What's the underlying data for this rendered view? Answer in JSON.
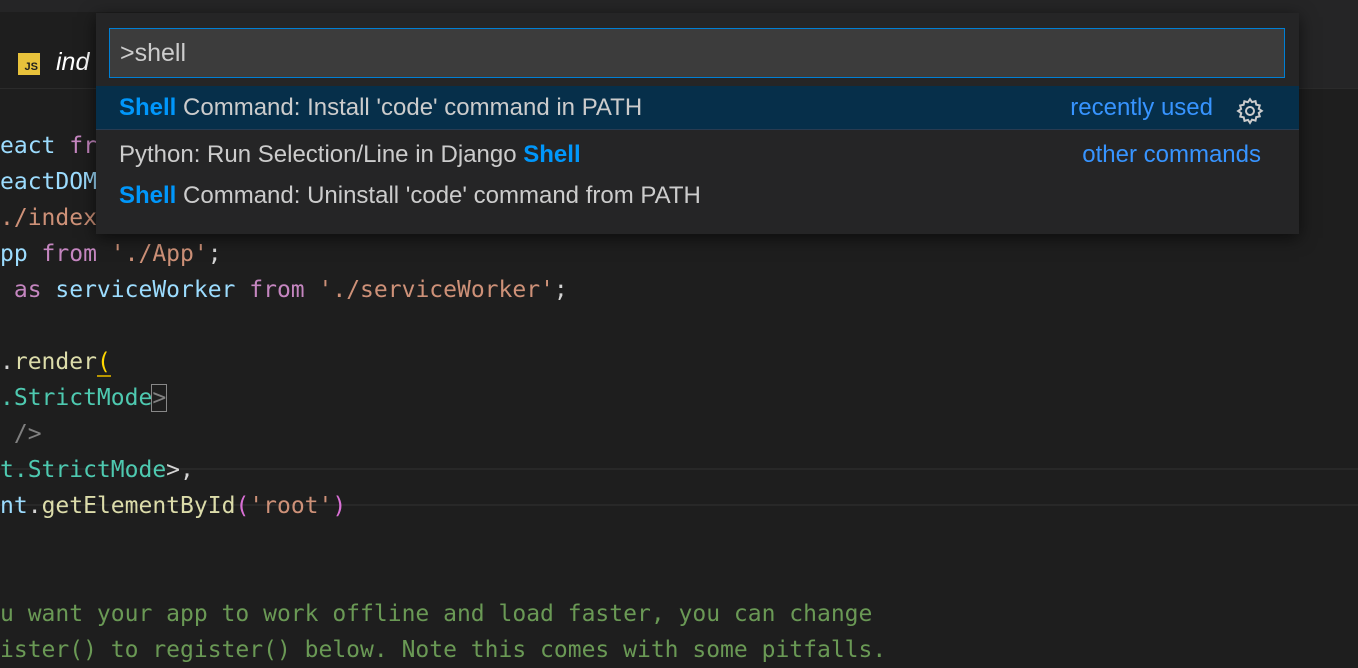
{
  "tab": {
    "icon_text": "JS",
    "title": "ind"
  },
  "code_lines": [
    {
      "segments": [
        {
          "t": "eact ",
          "c": "var"
        },
        {
          "t": "fr",
          "c": "kw"
        }
      ]
    },
    {
      "segments": [
        {
          "t": "eactDOM",
          "c": "var"
        }
      ]
    },
    {
      "segments": [
        {
          "t": "./index",
          "c": "str"
        }
      ]
    },
    {
      "segments": [
        {
          "t": "pp ",
          "c": "var"
        },
        {
          "t": "from ",
          "c": "kw"
        },
        {
          "t": "'./App'",
          "c": "str"
        },
        {
          "t": ";",
          "c": "punc"
        }
      ]
    },
    {
      "segments": [
        {
          "t": " as ",
          "c": "kw"
        },
        {
          "t": "serviceWorker ",
          "c": "var"
        },
        {
          "t": "from ",
          "c": "kw"
        },
        {
          "t": "'./serviceWorker'",
          "c": "str"
        },
        {
          "t": ";",
          "c": "punc"
        }
      ]
    },
    {
      "segments": []
    },
    {
      "segments": [
        {
          "t": ".",
          "c": "punc"
        },
        {
          "t": "render",
          "c": "fn"
        },
        {
          "t": "(",
          "c": "brY"
        }
      ]
    },
    {
      "segments": [
        {
          "t": ".StrictMode",
          "c": "tag"
        },
        {
          "t": ">",
          "c": "gray"
        }
      ]
    },
    {
      "segments": [
        {
          "t": " />",
          "c": "gray"
        }
      ]
    },
    {
      "segments": [
        {
          "t": "t.StrictMode",
          "c": "tag"
        },
        {
          "t": ">,",
          "c": "punc"
        }
      ]
    },
    {
      "segments": [
        {
          "t": "nt",
          "c": "var"
        },
        {
          "t": ".",
          "c": "punc"
        },
        {
          "t": "getElementById",
          "c": "fn"
        },
        {
          "t": "(",
          "c": "br"
        },
        {
          "t": "'root'",
          "c": "str"
        },
        {
          "t": ")",
          "c": "br"
        }
      ]
    },
    {
      "segments": []
    },
    {
      "segments": []
    },
    {
      "segments": [
        {
          "t": "u want your app to work offline and load faster, you can change",
          "c": "com"
        }
      ]
    },
    {
      "segments": [
        {
          "t": "ister() to register() below. Note this comes with some pitfalls.",
          "c": "com"
        }
      ]
    }
  ],
  "palette": {
    "input_value": ">shell",
    "items": [
      {
        "highlight": "Shell",
        "rest": " Command: Install 'code' command in PATH",
        "meta": "recently used",
        "selected": true
      },
      {
        "prefix": "Python: Run Selection/Line in Django ",
        "highlight": "Shell",
        "meta": "other commands",
        "selected": false
      },
      {
        "highlight": "Shell",
        "rest": " Command: Uninstall 'code' command from PATH",
        "meta": "",
        "selected": false
      }
    ]
  },
  "icons": {
    "gear": "gear-icon",
    "js": "js-file-icon"
  }
}
